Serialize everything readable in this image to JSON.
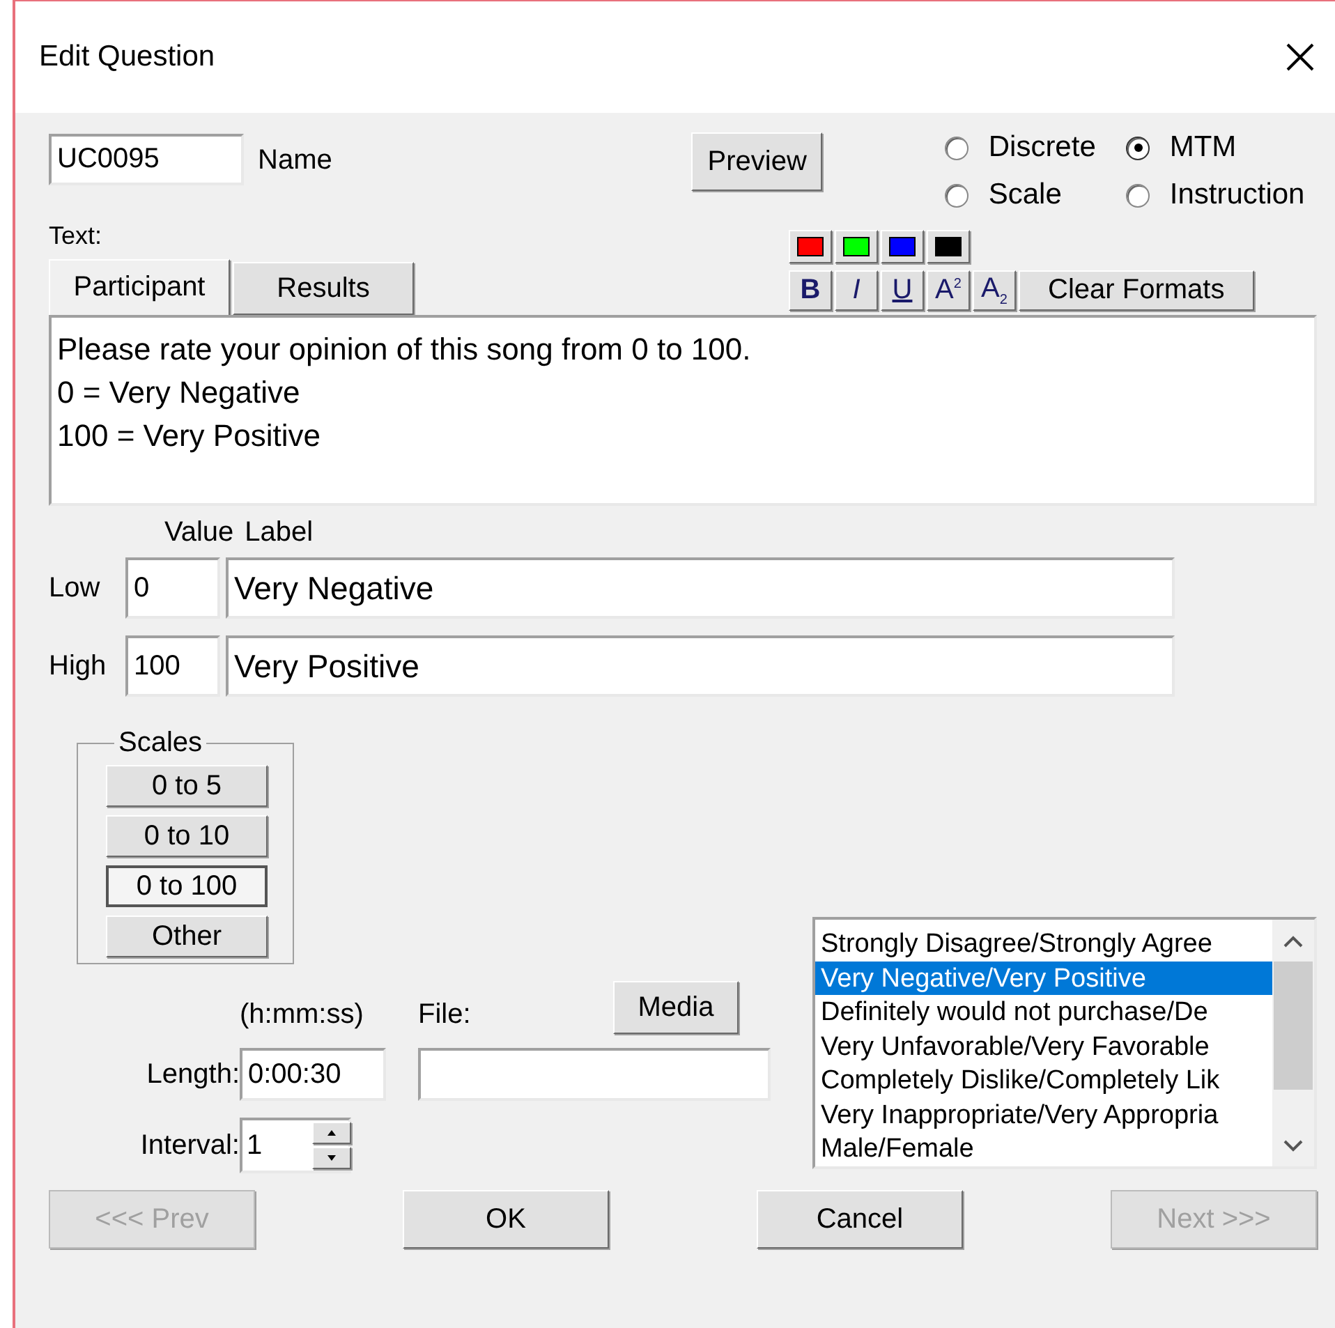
{
  "window": {
    "title": "Edit Question"
  },
  "name_field": {
    "value": "UC0095",
    "label": "Name"
  },
  "preview_button": "Preview",
  "question_types": [
    {
      "label": "Discrete",
      "selected": false
    },
    {
      "label": "MTM",
      "selected": true
    },
    {
      "label": "Scale",
      "selected": false
    },
    {
      "label": "Instruction",
      "selected": false
    }
  ],
  "text_label": "Text:",
  "text_tabs": [
    {
      "label": "Participant",
      "selected": true
    },
    {
      "label": "Results",
      "selected": false
    }
  ],
  "color_buttons": [
    {
      "color": "#ff0000"
    },
    {
      "color": "#00ff00"
    },
    {
      "color": "#0000ff"
    },
    {
      "color": "#000000"
    }
  ],
  "format_buttons": [
    {
      "kind": "bold",
      "label": "B"
    },
    {
      "kind": "italic",
      "label": "I"
    },
    {
      "kind": "underline",
      "label": "U"
    },
    {
      "kind": "superscript",
      "label": "A$^{2}$"
    },
    {
      "kind": "subscript",
      "label": "A$_{2}$"
    },
    {
      "kind": "plain",
      "label": "Clear Formats"
    }
  ],
  "question_text": [
    "Please rate your opinion of this song from 0 to 100.",
    "0 = Very Negative",
    "100 = Very Positive"
  ],
  "range_headers": {
    "value": "Value",
    "label": "Label"
  },
  "range_rows": [
    {
      "name": "Low",
      "value": "0",
      "label": "Very Negative"
    },
    {
      "name": "High",
      "value": "100",
      "label": "Very Positive"
    }
  ],
  "scales": {
    "title": "Scales",
    "buttons": [
      {
        "label": "0 to 5",
        "selected": false
      },
      {
        "label": "0 to 10",
        "selected": false
      },
      {
        "label": "0 to 100",
        "selected": true
      },
      {
        "label": "Other",
        "selected": false
      }
    ]
  },
  "media": {
    "length_hint": "(h:mm:ss)",
    "file_label": "File:",
    "media_button": "Media",
    "length_label": "Length:",
    "length_value": "0:00:30",
    "interval_label": "Interval:",
    "interval_value": "1"
  },
  "scale_presets": [
    {
      "label": "Strongly Disagree/Strongly Agree",
      "selected": false
    },
    {
      "label": "Very Negative/Very Positive",
      "selected": true
    },
    {
      "label": "Definitely would not purchase/De",
      "selected": false
    },
    {
      "label": "Very Unfavorable/Very Favorable",
      "selected": false
    },
    {
      "label": "Completely Dislike/Completely Lik",
      "selected": false
    },
    {
      "label": "Very Inappropriate/Very Appropria",
      "selected": false
    },
    {
      "label": "Male/Female",
      "selected": false
    }
  ],
  "footer_buttons": [
    {
      "label": "<<< Prev",
      "disabled": true
    },
    {
      "label": "OK",
      "disabled": false
    },
    {
      "label": "Cancel",
      "disabled": false
    },
    {
      "label": "Next >>>",
      "disabled": true
    }
  ]
}
